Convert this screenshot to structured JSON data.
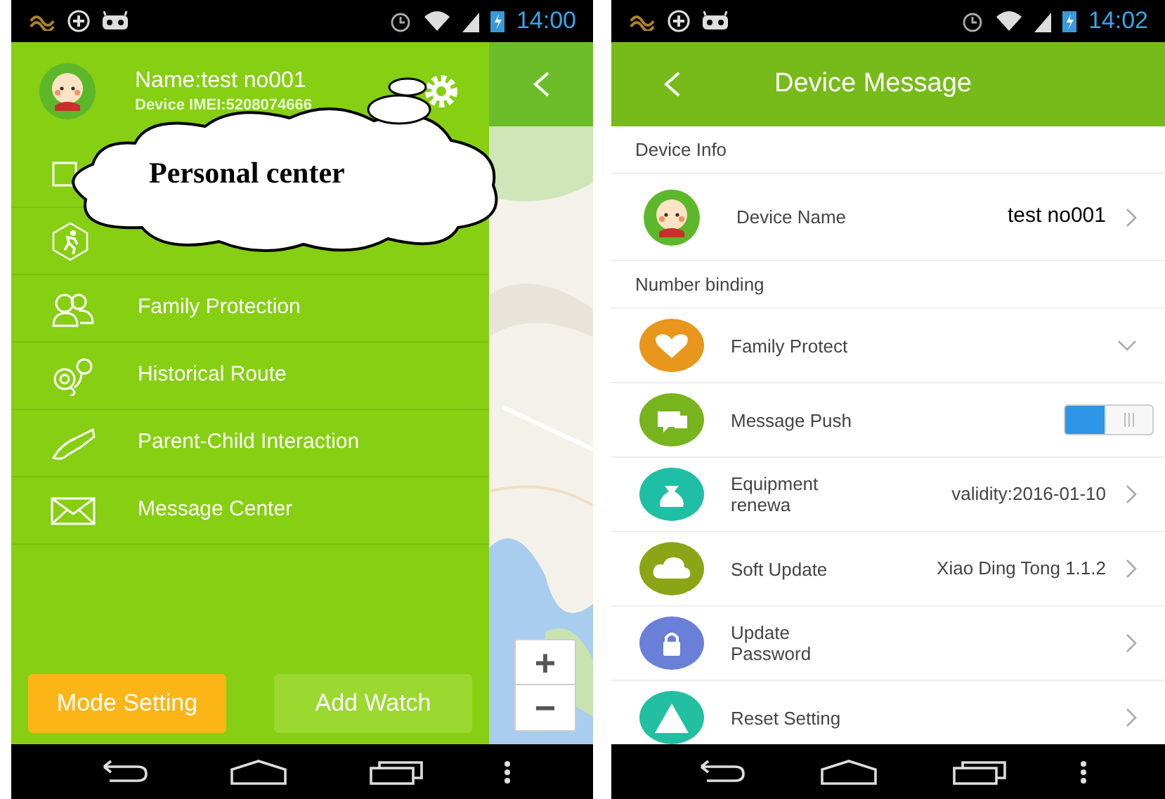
{
  "left_phone": {
    "status_bar": {
      "time": "14:00"
    },
    "drawer": {
      "profile": {
        "name": "Name:test no001",
        "imei": "Device IMEI:5208074666"
      },
      "menu": [
        {
          "label": "Family Protection"
        },
        {
          "label": "Historical Route"
        },
        {
          "label": "Parent-Child Interaction"
        },
        {
          "label": "Message Center"
        }
      ],
      "buttons": [
        {
          "label": "Mode Setting",
          "kind": "accent"
        },
        {
          "label": "Add Watch",
          "kind": "plain"
        }
      ]
    },
    "map": {
      "kind": "picture",
      "zoom_in": "+",
      "zoom_out": "−"
    },
    "callout": "Personal center"
  },
  "right_phone": {
    "status_bar": {
      "time": "14:02"
    },
    "title": "Device Message",
    "sections": [
      {
        "title": "Device Info",
        "rows": [
          {
            "kind": "avatar",
            "label": "Device Name",
            "value": "test no001",
            "color": "#5cb82a"
          }
        ]
      },
      {
        "title": "Number binding",
        "rows": [
          {
            "kind": "expand",
            "label": "Family Protect",
            "expanded": false,
            "color": "#e8961c"
          },
          {
            "kind": "toggle",
            "label": "Message Push",
            "on": true,
            "color": "#78b41e"
          },
          {
            "kind": "link",
            "label": "Equipment renewa",
            "value": "validity:2016-01-10",
            "color": "#1fbfa5"
          },
          {
            "kind": "link",
            "label": "Soft Update",
            "value": "Xiao Ding Tong 1.1.2",
            "color": "#8ba516"
          },
          {
            "kind": "link",
            "label": "Update Password",
            "color": "#6a7fd8"
          },
          {
            "kind": "link",
            "label": "Reset Setting",
            "color": "#22bfa3"
          }
        ]
      }
    ]
  }
}
